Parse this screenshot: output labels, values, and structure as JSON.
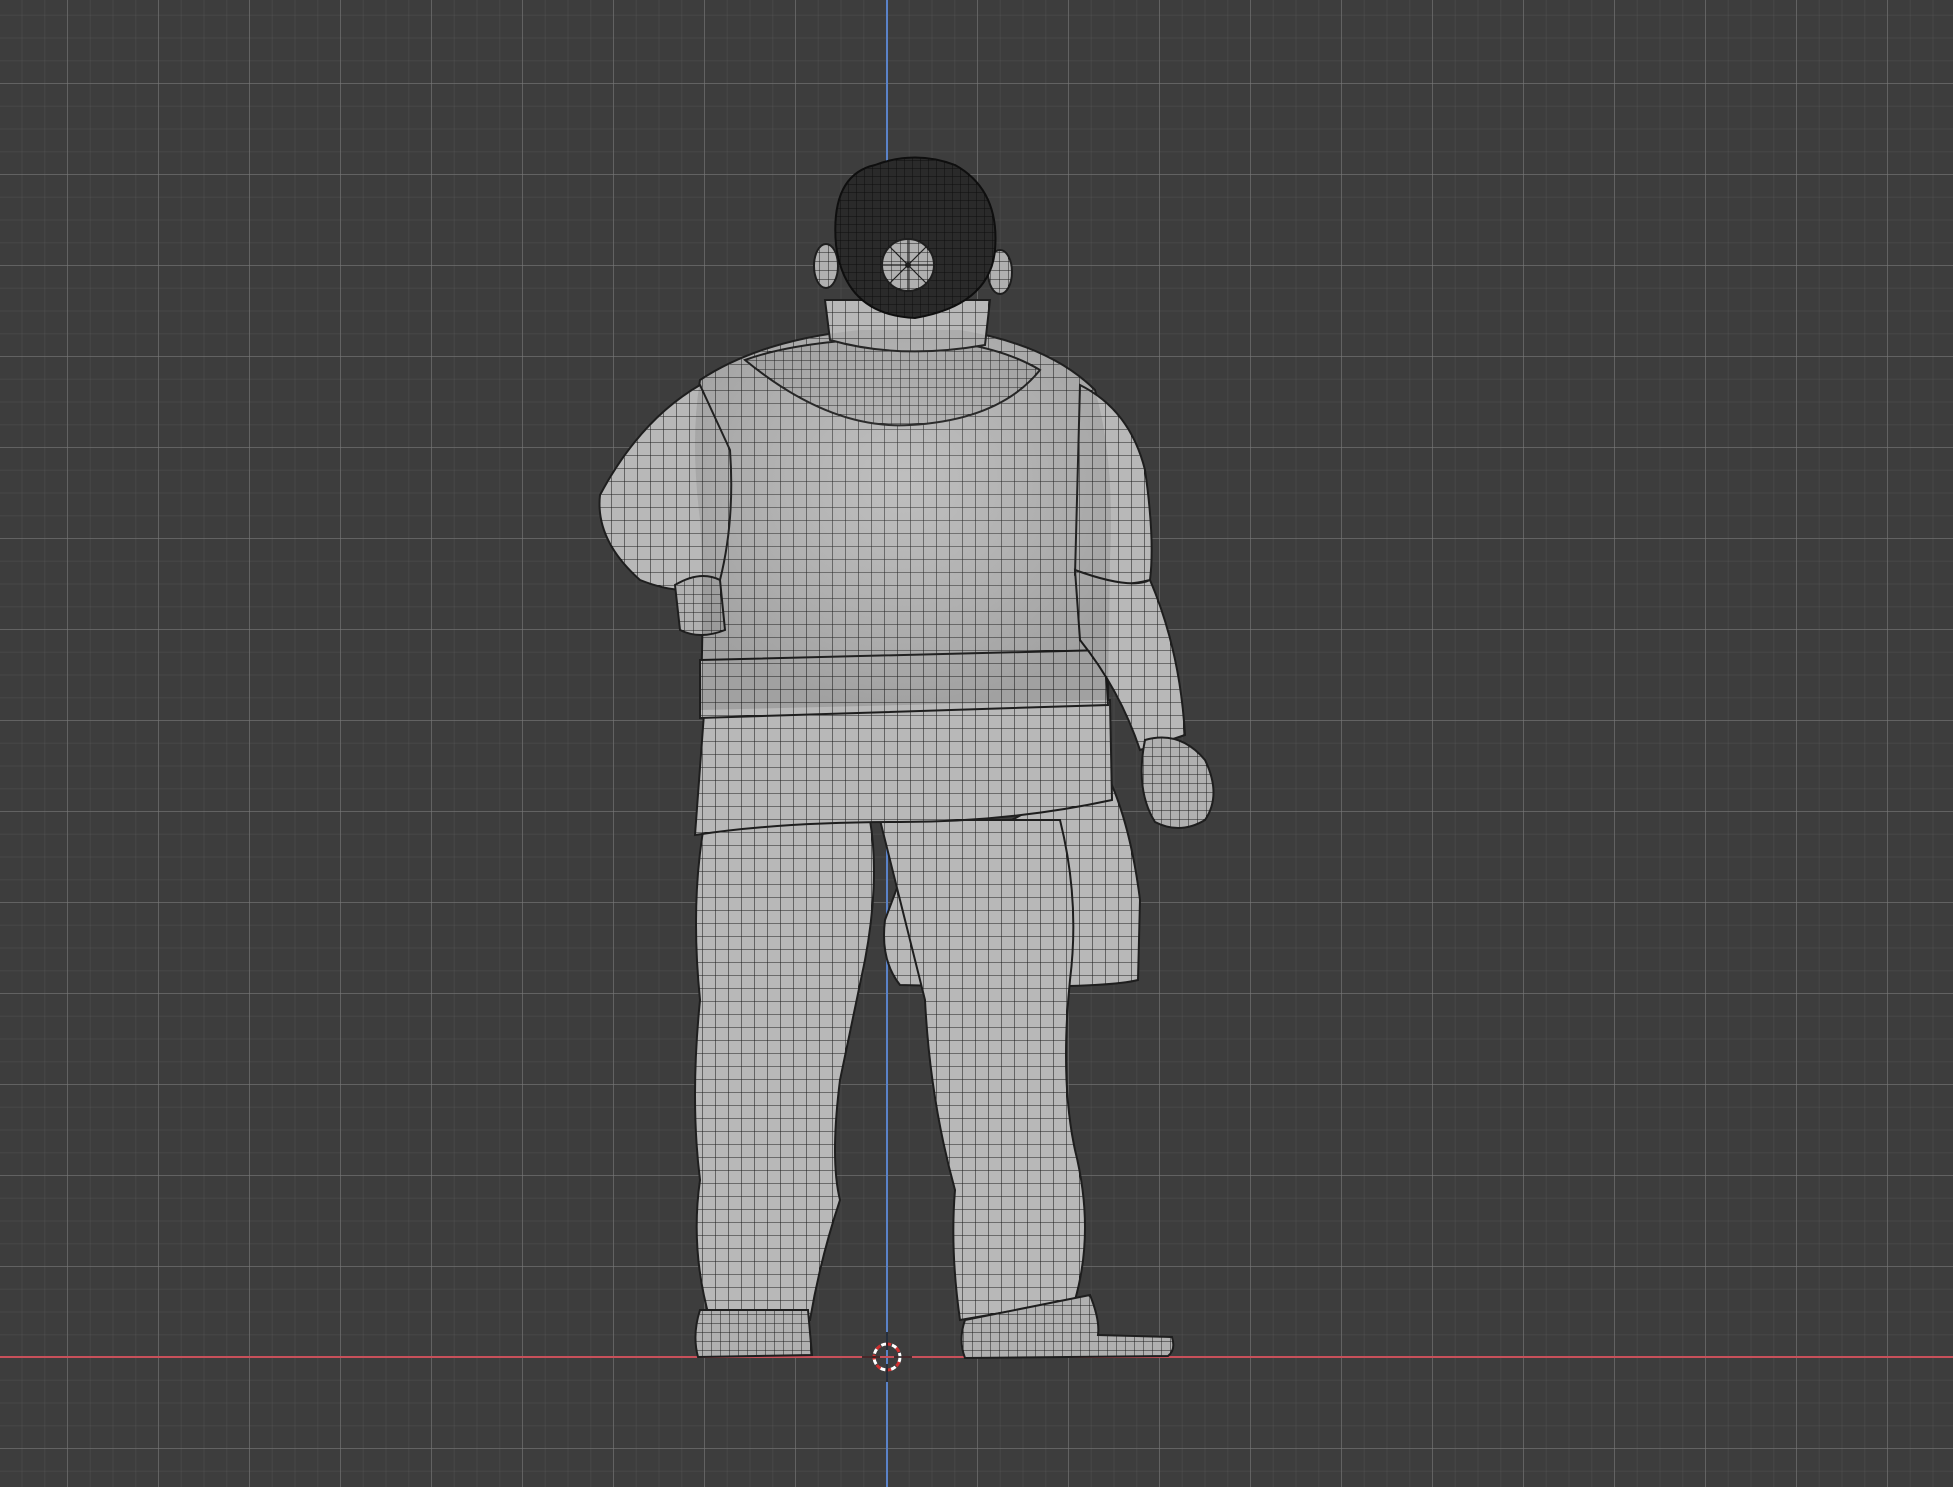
{
  "viewport": {
    "background_color": "#3d3d3d",
    "grid_color": "#5a5a5a",
    "axis_x_color": "#c8505a",
    "axis_z_color": "#5a82c8",
    "model_fill": "#b4b4b4",
    "wire_color": "#1e1e1e",
    "hair_color": "#1a1a1a"
  },
  "objects": {
    "model_name": "character-mesh",
    "cursor_name": "3d-cursor"
  }
}
